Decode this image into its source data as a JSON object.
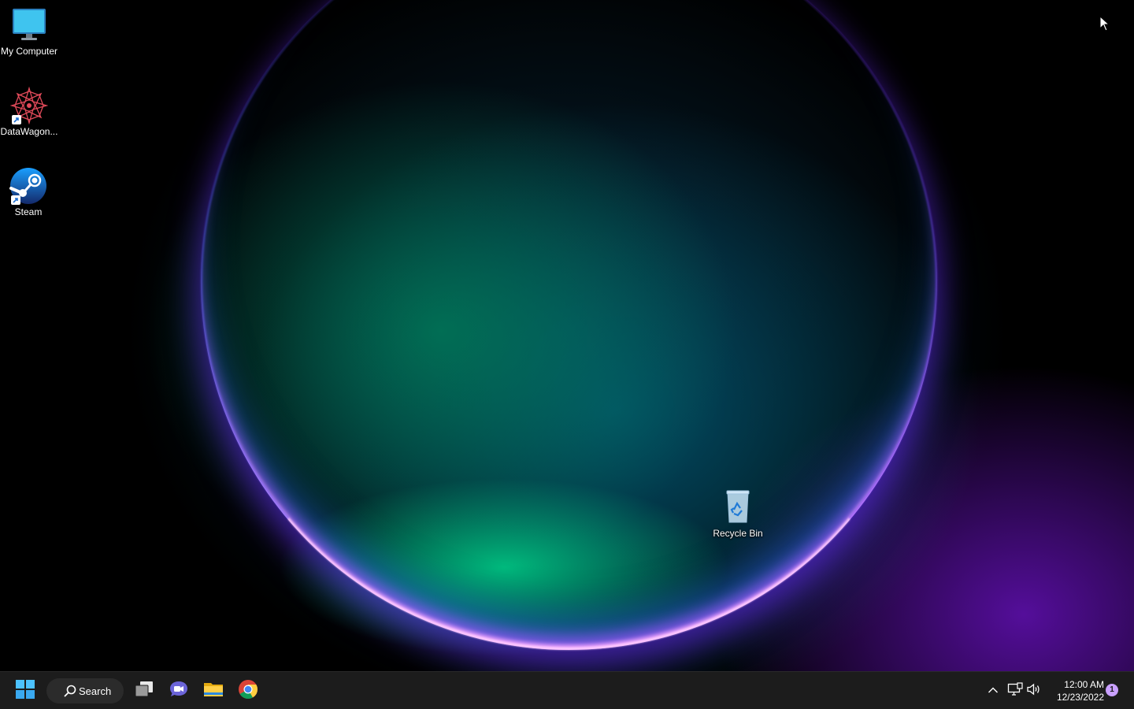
{
  "desktop": {
    "icons": [
      {
        "label": "My Computer",
        "icon": "monitor-icon"
      },
      {
        "label": "DataWagon...",
        "icon": "datawagon-app-icon",
        "shortcut": true
      },
      {
        "label": "Steam",
        "icon": "steam-icon",
        "shortcut": true
      },
      {
        "label": "Recycle Bin",
        "icon": "recycle-bin-icon"
      }
    ]
  },
  "taskbar": {
    "start_icon": "windows-logo-icon",
    "search": {
      "label": "Search",
      "icon": "search-icon"
    },
    "pinned": [
      {
        "name": "task-view",
        "icon": "task-view-icon"
      },
      {
        "name": "teams-chat",
        "icon": "chat-icon"
      },
      {
        "name": "file-explorer",
        "icon": "folder-icon"
      },
      {
        "name": "chrome",
        "icon": "chrome-icon"
      }
    ],
    "tray": {
      "overflow_icon": "chevron-up-icon",
      "network_icon": "network-icon",
      "volume_icon": "speaker-icon"
    },
    "clock": {
      "time": "12:00 AM",
      "date": "12/23/2022"
    },
    "notifications": {
      "count": "1"
    }
  },
  "colors": {
    "taskbar_bg": "#1c1c1c",
    "accent": "#0078d4",
    "badge": "#c9a0ff"
  }
}
